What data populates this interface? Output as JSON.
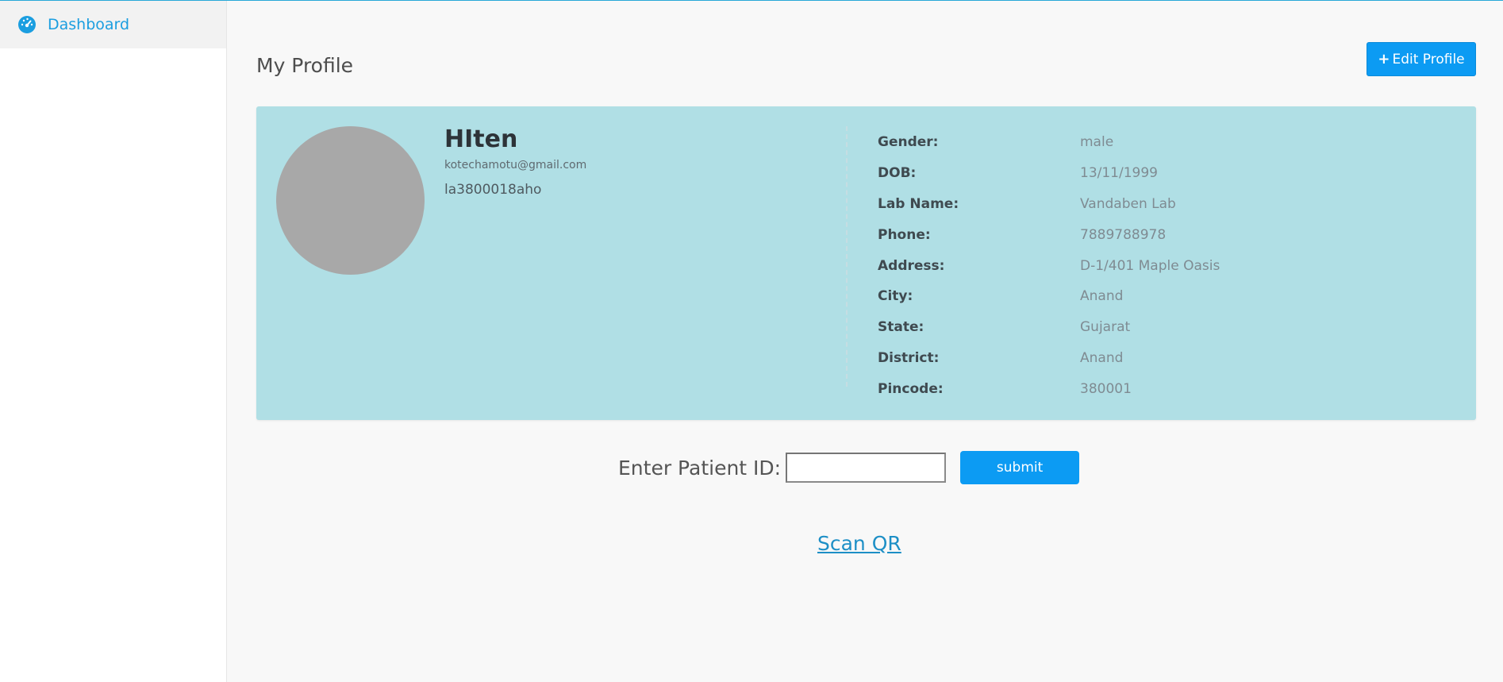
{
  "sidebar": {
    "items": [
      {
        "label": "Dashboard",
        "icon": "dashboard-gauge-icon"
      }
    ]
  },
  "header": {
    "title": "My Profile",
    "edit_button_label": "Edit Profile",
    "edit_button_icon": "plus-icon"
  },
  "profile": {
    "name": "HIten",
    "email": "kotechamotu@gmail.com",
    "id": "la3800018aho",
    "details": [
      {
        "key": "Gender:",
        "value": "male"
      },
      {
        "key": "DOB:",
        "value": "13/11/1999"
      },
      {
        "key": "Lab Name:",
        "value": "Vandaben Lab"
      },
      {
        "key": "Phone:",
        "value": "7889788978"
      },
      {
        "key": "Address:",
        "value": "D-1/401 Maple Oasis"
      },
      {
        "key": "City:",
        "value": "Anand"
      },
      {
        "key": "State:",
        "value": "Gujarat"
      },
      {
        "key": "District:",
        "value": "Anand"
      },
      {
        "key": "Pincode:",
        "value": "380001"
      }
    ]
  },
  "patient_form": {
    "label": "Enter Patient ID:",
    "input_value": "",
    "submit_label": "submit"
  },
  "scan_qr_label": "Scan QR",
  "colors": {
    "accent": "#0c9bf3",
    "link": "#1d8fc6",
    "card_bg": "#b0dfe5",
    "avatar": "#a8a8a8"
  }
}
